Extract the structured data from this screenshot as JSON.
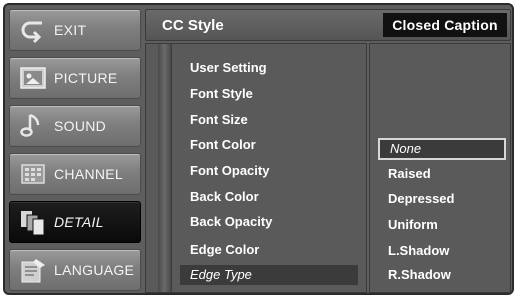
{
  "menu": {
    "items": [
      {
        "label": "EXIT",
        "icon": "exit-icon"
      },
      {
        "label": "PICTURE",
        "icon": "picture-icon"
      },
      {
        "label": "SOUND",
        "icon": "sound-icon"
      },
      {
        "label": "CHANNEL",
        "icon": "channel-icon"
      },
      {
        "label": "DETAIL",
        "icon": "detail-icon",
        "active": true
      },
      {
        "label": "LANGUAGE",
        "icon": "language-icon"
      }
    ]
  },
  "header": {
    "title": "CC Style",
    "badge": "Closed Caption"
  },
  "settings": {
    "items": [
      {
        "label": "User Setting"
      },
      {
        "label": "Font Style"
      },
      {
        "label": "Font Size"
      },
      {
        "label": "Font Color"
      },
      {
        "label": "Font Opacity"
      },
      {
        "label": "Back Color"
      },
      {
        "label": "Back Opacity"
      },
      {
        "label": "Edge Color"
      },
      {
        "label": "Edge Type",
        "selected": true
      }
    ]
  },
  "options": {
    "items": [
      {
        "label": "None",
        "selected": true
      },
      {
        "label": "Raised"
      },
      {
        "label": "Depressed"
      },
      {
        "label": "Uniform"
      },
      {
        "label": "L.Shadow"
      },
      {
        "label": "R.Shadow"
      }
    ]
  },
  "colors": {
    "background": "#5e5e5e",
    "active_menu": "#0a0a0a",
    "badge": "#111111",
    "text": "#ffffff"
  }
}
